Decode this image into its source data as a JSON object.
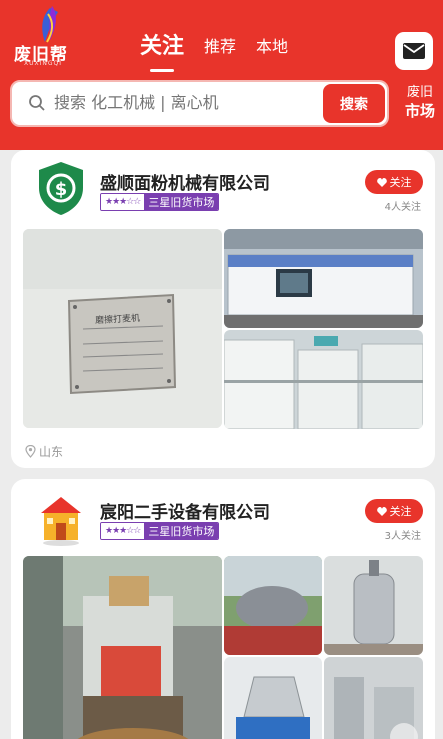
{
  "header": {
    "logo_text": "废旧帮",
    "logo_sub": "XUXINGQI",
    "tabs": [
      {
        "label": "关注",
        "active": true
      },
      {
        "label": "推荐",
        "active": false
      },
      {
        "label": "本地",
        "active": false
      }
    ],
    "mail_icon": "mail-icon"
  },
  "search": {
    "placeholder": "搜索 化工机械 | 离心机",
    "button_label": "搜索",
    "market_line1": "废旧",
    "market_line2": "市场"
  },
  "colors": {
    "brand": "#e8342b",
    "badge_purple": "#7a3fb0",
    "shield_green": "#1e8a4a"
  },
  "companies": [
    {
      "name": "盛顺面粉机械有限公司",
      "stars": "★★★☆☆",
      "badge": "三星旧货市场",
      "follow_label": "关注",
      "follow_count": "4人关注",
      "location": "山东",
      "plate_text": "磨擦打麦机",
      "logo_icon": "dollar-shield-icon"
    },
    {
      "name": "宸阳二手设备有限公司",
      "stars": "★★★☆☆",
      "badge": "三星旧货市场",
      "follow_label": "关注",
      "follow_count": "3人关注",
      "logo_icon": "house-icon"
    }
  ]
}
